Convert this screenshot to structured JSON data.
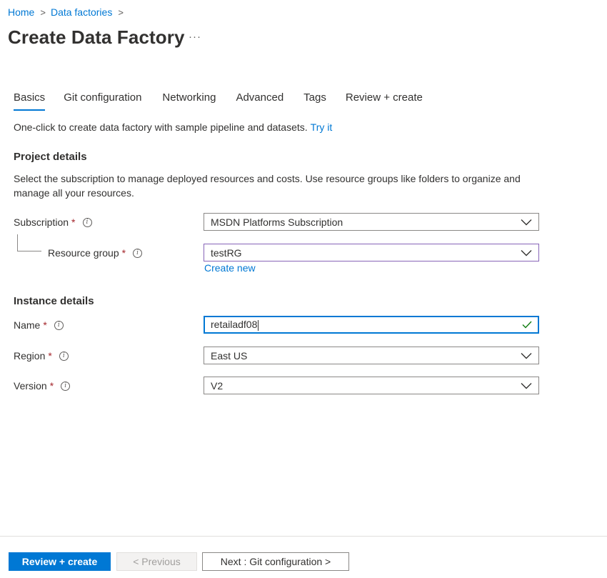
{
  "breadcrumb": {
    "home": "Home",
    "data_factories": "Data factories",
    "separator": ">"
  },
  "page": {
    "title": "Create Data Factory",
    "more": "···"
  },
  "tabs": [
    {
      "label": "Basics",
      "active": true
    },
    {
      "label": "Git configuration",
      "active": false
    },
    {
      "label": "Networking",
      "active": false
    },
    {
      "label": "Advanced",
      "active": false
    },
    {
      "label": "Tags",
      "active": false
    },
    {
      "label": "Review + create",
      "active": false
    }
  ],
  "intro": {
    "text": "One-click to create data factory with sample pipeline and datasets.",
    "link": "Try it"
  },
  "project_details": {
    "title": "Project details",
    "description": "Select the subscription to manage deployed resources and costs. Use resource groups like folders to organize and manage all your resources.",
    "subscription": {
      "label": "Subscription",
      "required": "*",
      "value": "MSDN Platforms Subscription"
    },
    "resource_group": {
      "label": "Resource group",
      "required": "*",
      "value": "testRG",
      "create_new": "Create new"
    }
  },
  "instance_details": {
    "title": "Instance details",
    "name": {
      "label": "Name",
      "required": "*",
      "value": "retailadf08"
    },
    "region": {
      "label": "Region",
      "required": "*",
      "value": "East US"
    },
    "version": {
      "label": "Version",
      "required": "*",
      "value": "V2"
    }
  },
  "footer": {
    "review_create": "Review + create",
    "previous": "< Previous",
    "next": "Next : Git configuration >"
  },
  "colors": {
    "accent": "#0078d4",
    "required": "#a4262c",
    "valid": "#107c10",
    "focus_purple": "#8764b8"
  },
  "icons": {
    "info": "info-icon",
    "chevron": "chevron-down-icon",
    "check": "checkmark-icon",
    "more": "more-icon"
  }
}
